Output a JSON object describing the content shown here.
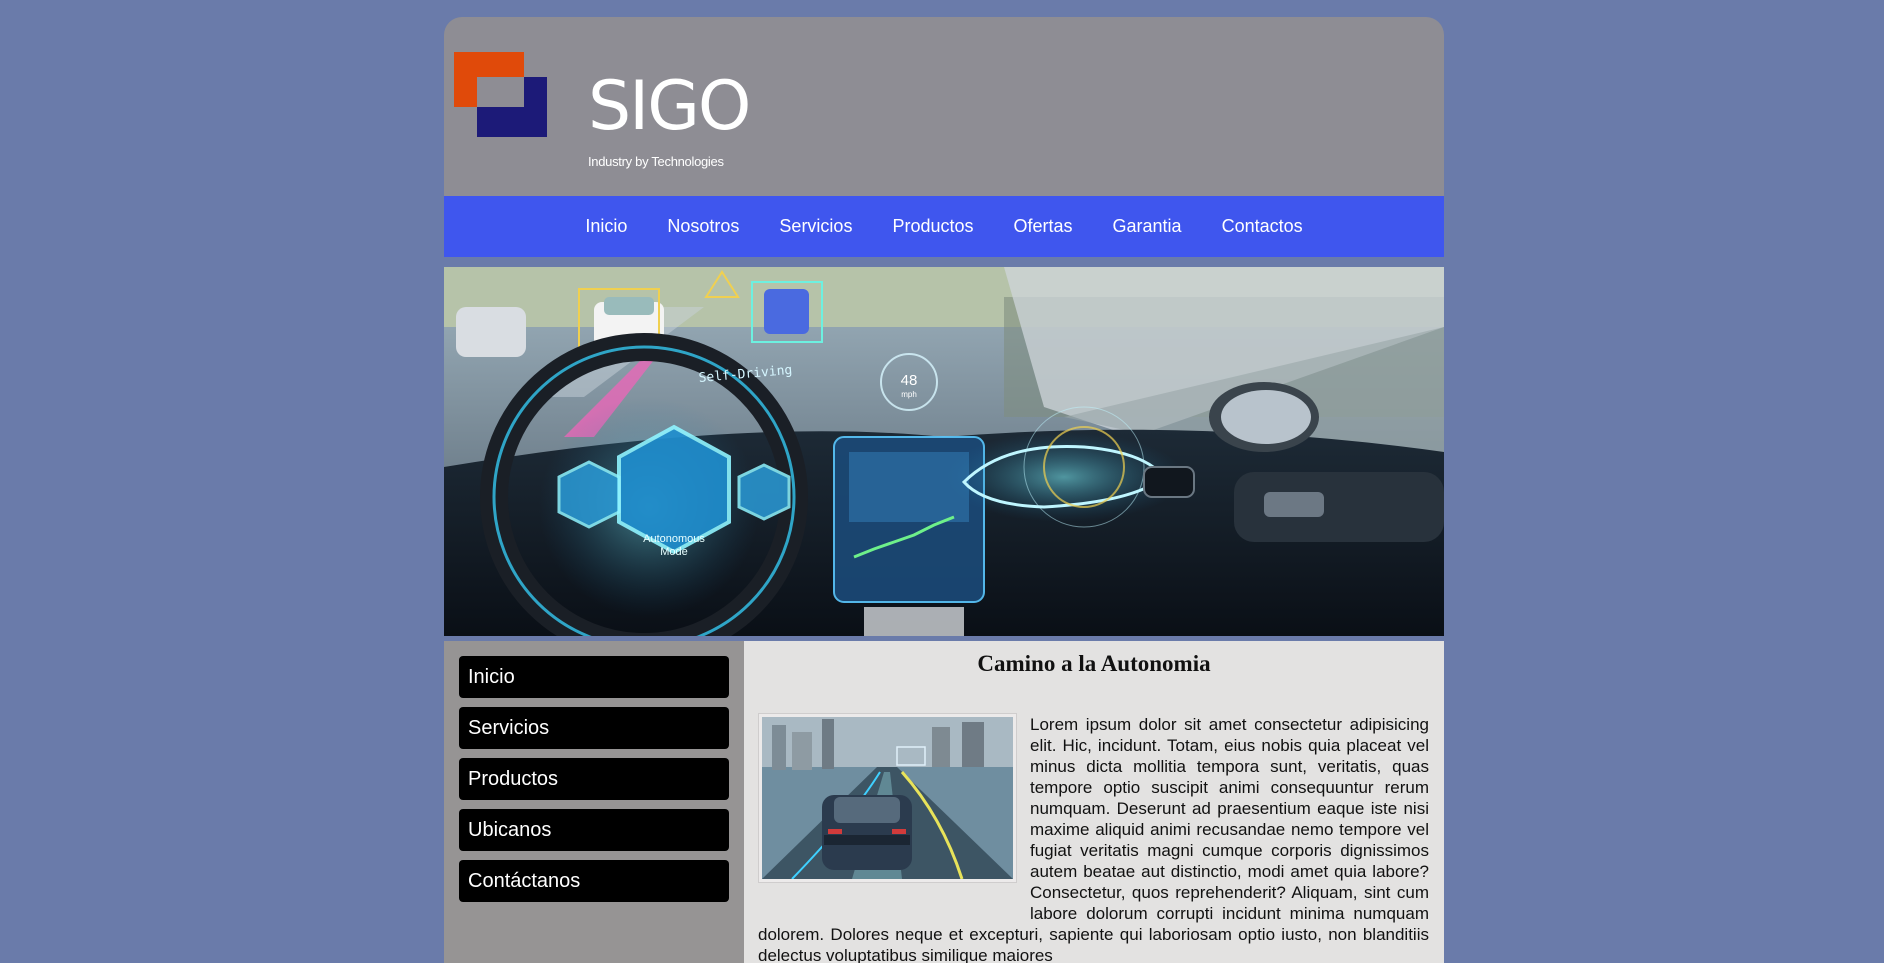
{
  "brand": {
    "name": "SIGO",
    "tagline": "Industry by Technologies",
    "colors": {
      "orange": "#e04a0a",
      "navy": "#1c1a78"
    }
  },
  "nav": {
    "items": [
      "Inicio",
      "Nosotros",
      "Servicios",
      "Productos",
      "Ofertas",
      "Garantia",
      "Contactos"
    ]
  },
  "hero": {
    "speed": "48",
    "speed_unit": "mph",
    "mode_label_1": "Autonomous",
    "mode_label_2": "Mode",
    "self_driving": "Self-Driving"
  },
  "sidebar": {
    "items": [
      "Inicio",
      "Servicios",
      "Productos",
      "Ubicanos",
      "Contáctanos"
    ]
  },
  "content": {
    "title": "Camino a la Autonomia",
    "body": "Lorem ipsum dolor sit amet consectetur adipisicing elit. Hic, incidunt. Totam, eius nobis quia placeat vel minus dicta mollitia tempora sunt, veritatis, quas tempore optio suscipit animi consequuntur rerum numquam. Deserunt ad praesentium eaque iste nisi maxime aliquid animi recusandae nemo tempore vel fugiat veritatis magni cumque corporis dignissimos autem beatae aut distinctio, modi amet quia labore? Consectetur, quos reprehenderit? Aliquam, sint cum labore dolorum corrupti incidunt minima numquam dolorem. Dolores neque et excepturi, sapiente qui laboriosam optio iusto, non blanditiis delectus voluptatibus similique maiores"
  }
}
